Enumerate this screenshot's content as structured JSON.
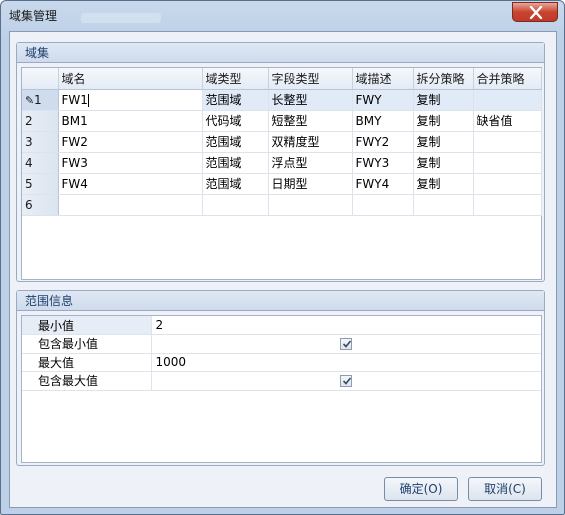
{
  "window": {
    "title": "域集管理"
  },
  "domain_group": {
    "title": "域集",
    "columns": [
      "域名",
      "域类型",
      "字段类型",
      "域描述",
      "拆分策略",
      "合并策略"
    ],
    "rows": [
      {
        "num": "1",
        "name": "FW1",
        "type": "范围域",
        "field_type": "长整型",
        "desc": "FWY",
        "split": "复制",
        "merge": ""
      },
      {
        "num": "2",
        "name": "BM1",
        "type": "代码域",
        "field_type": "短整型",
        "desc": "BMY",
        "split": "复制",
        "merge": "缺省值"
      },
      {
        "num": "3",
        "name": "FW2",
        "type": "范围域",
        "field_type": "双精度型",
        "desc": "FWY2",
        "split": "复制",
        "merge": ""
      },
      {
        "num": "4",
        "name": "FW3",
        "type": "范围域",
        "field_type": "浮点型",
        "desc": "FWY3",
        "split": "复制",
        "merge": ""
      },
      {
        "num": "5",
        "name": "FW4",
        "type": "范围域",
        "field_type": "日期型",
        "desc": "FWY4",
        "split": "复制",
        "merge": ""
      },
      {
        "num": "6",
        "name": "",
        "type": "",
        "field_type": "",
        "desc": "",
        "split": "",
        "merge": ""
      }
    ]
  },
  "range_group": {
    "title": "范围信息",
    "props": [
      {
        "label": "最小值",
        "value": "2",
        "checkbox": false
      },
      {
        "label": "包含最小值",
        "value": "",
        "checkbox": true,
        "checked": true
      },
      {
        "label": "最大值",
        "value": "1000",
        "checkbox": false
      },
      {
        "label": "包含最大值",
        "value": "",
        "checkbox": true,
        "checked": true
      }
    ]
  },
  "buttons": {
    "ok": "确定(O)",
    "cancel": "取消(C)"
  },
  "icons": {
    "close": "close-icon",
    "edit": "pencil-icon",
    "check": "check-icon"
  },
  "colors": {
    "title_bar": "#bdd0e8",
    "close_button": "#c0392b",
    "group_title": "#1e3f6c"
  }
}
